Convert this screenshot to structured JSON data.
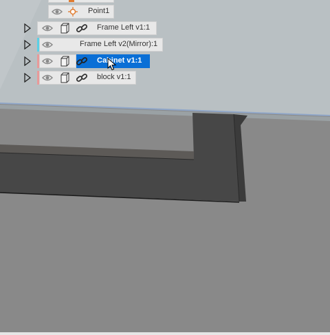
{
  "browser": {
    "items": [
      {
        "label": "Point1",
        "type": "point",
        "selected": false,
        "stripe": ""
      },
      {
        "label": "Frame Left v1:1",
        "type": "component",
        "selected": false,
        "stripe": ""
      },
      {
        "label": "Frame Left v2(Mirror):1",
        "type": "component",
        "selected": false,
        "stripe": "#5ad0e6"
      },
      {
        "label": "Cabinet v1:1",
        "type": "component",
        "selected": true,
        "stripe": "#e89a9a"
      },
      {
        "label": "block v1:1",
        "type": "component",
        "selected": false,
        "stripe": "#e89a9a"
      }
    ]
  },
  "colors": {
    "selection": "#0a6fd6",
    "ground_plane": "#b5bcbf",
    "body_shadow": "#4a4a4a",
    "background": "#8a8a8a",
    "point_icon": "#e07b2e"
  },
  "icons": [
    "visibility-eye-icon",
    "component-box-icon",
    "link-chain-icon",
    "origin-point-icon",
    "expand-triangle-icon",
    "mouse-pointer-icon"
  ]
}
